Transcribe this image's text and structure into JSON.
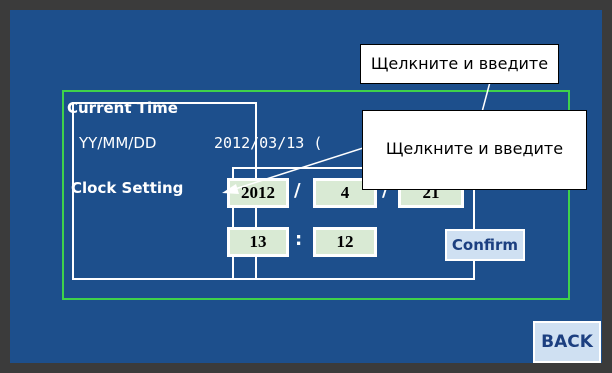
{
  "labels": {
    "current_time": "Current Time",
    "date_format": "YY/MM/DD",
    "current_value": "2012/03/13 (",
    "clock_setting": "Clock Setting"
  },
  "clock_setting": {
    "year": "2012",
    "month": "4",
    "day": "21",
    "hour": "13",
    "minute": "12",
    "date_separator": "/",
    "time_separator": ":"
  },
  "buttons": {
    "confirm": "Confirm",
    "back": "BACK"
  },
  "callouts": {
    "top": "Щелкните и введите",
    "middle": "Щелкните и введите"
  },
  "colors": {
    "background": "#1d4f8c",
    "frame_green": "#3fd24a",
    "field_fill": "#d9ead4",
    "button_fill": "#cfe0f2",
    "button_text": "#1c3f80"
  }
}
